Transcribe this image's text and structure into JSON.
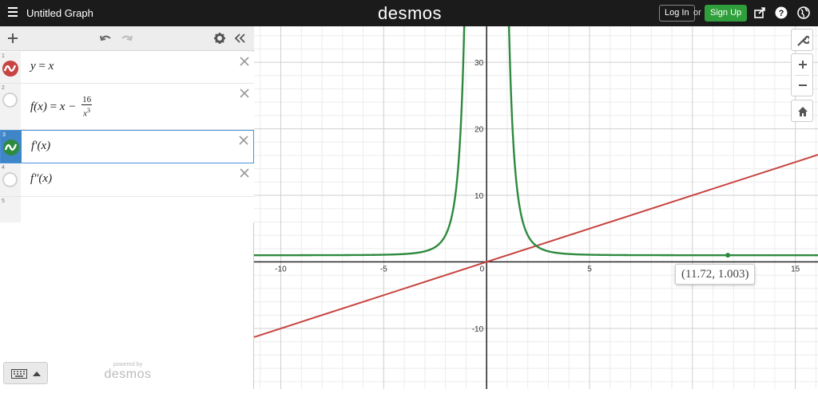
{
  "topbar": {
    "title": "Untitled Graph",
    "logo": "desmos",
    "login_label": "Log In",
    "or_text": "or",
    "signup_label": "Sign Up",
    "icons": [
      "hamburger-icon",
      "share-icon",
      "help-icon",
      "globe-icon"
    ]
  },
  "panel": {
    "toolbar_icons": [
      "add-icon",
      "undo-icon",
      "redo-icon",
      "gear-icon",
      "collapse-icon"
    ],
    "expressions": [
      {
        "number": "1",
        "lhs": "y",
        "rhs": "x",
        "color": "#c74440",
        "visible": true
      },
      {
        "number": "2",
        "lhs": "f(x)",
        "rhs": "x −",
        "frac_num": "16",
        "frac_den": "x",
        "frac_exp": "3",
        "color": "none",
        "visible": false
      },
      {
        "number": "3",
        "text": "f′(x)",
        "color": "#2d8a3e",
        "visible": true,
        "selected": true
      },
      {
        "number": "4",
        "text": "f″(x)",
        "color": "none",
        "visible": false
      },
      {
        "number": "5"
      }
    ],
    "powered_small": "powered by",
    "powered_big": "desmos"
  },
  "graph": {
    "x_ticks": [
      "-10",
      "-5",
      "0",
      "5",
      "10",
      "15"
    ],
    "y_ticks": [
      "30",
      "20",
      "10",
      "-10"
    ],
    "xlim": [
      -11.3,
      16.1
    ],
    "ylim": [
      -19.1,
      35.4
    ],
    "point_label": "(11.72, 1.003)",
    "tool_icons": [
      "wrench-icon",
      "zoom-in-icon",
      "zoom-out-icon",
      "home-icon"
    ]
  },
  "colors": {
    "red": "#c74440",
    "green": "#2d8a3e",
    "blue_select": "#3f86c8",
    "topbar": "#1b1b1b",
    "signup": "#2f9f3b"
  }
}
